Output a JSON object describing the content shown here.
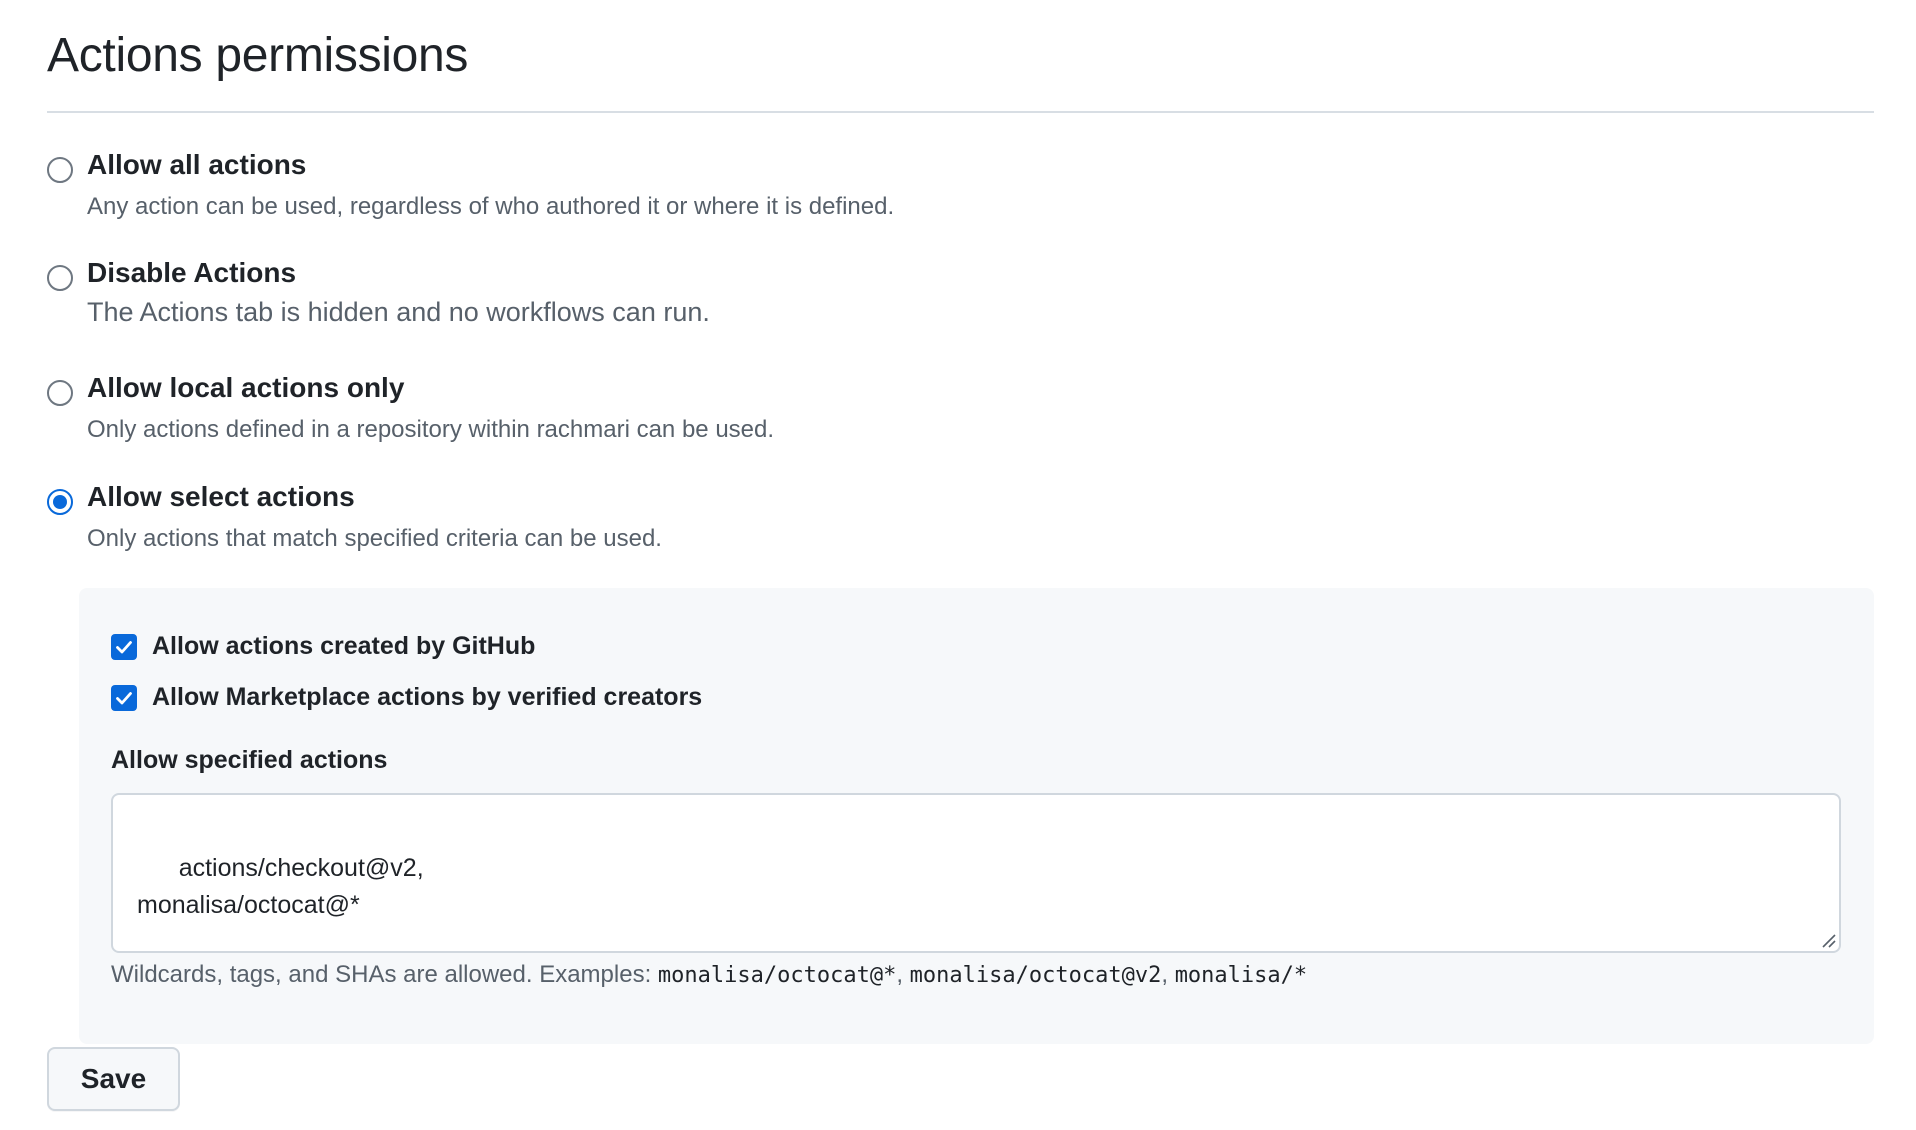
{
  "page": {
    "title": "Actions permissions"
  },
  "options": [
    {
      "label": "Allow all actions",
      "description": "Any action can be used, regardless of who authored it or where it is defined.",
      "selected": false
    },
    {
      "label": "Disable Actions",
      "description": "The Actions tab is hidden and no workflows can run.",
      "selected": false
    },
    {
      "label": "Allow local actions only",
      "description": "Only actions defined in a repository within rachmari can be used.",
      "selected": false
    },
    {
      "label": "Allow select actions",
      "description": "Only actions that match specified criteria can be used.",
      "selected": true
    }
  ],
  "select_actions": {
    "checkboxes": [
      {
        "label": "Allow actions created by GitHub",
        "checked": true
      },
      {
        "label": "Allow Marketplace actions by verified creators",
        "checked": true
      }
    ],
    "field_label": "Allow specified actions",
    "field_value": "actions/checkout@v2,\nmonalisa/octocat@*",
    "hint_prefix": "Wildcards, tags, and SHAs are allowed. Examples: ",
    "hint_examples": [
      "monalisa/octocat@*",
      "monalisa/octocat@v2",
      "monalisa/*"
    ],
    "hint_separator": ", "
  },
  "buttons": {
    "save_label": "Save"
  },
  "colors": {
    "accent": "#0969da",
    "panel_background": "#f6f8fa",
    "muted_text": "#57606a",
    "border": "#d0d7de"
  }
}
